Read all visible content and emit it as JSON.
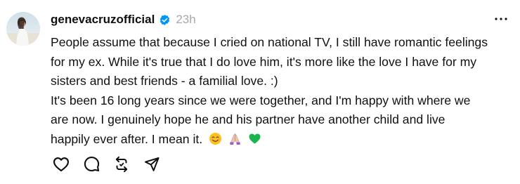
{
  "post": {
    "author": {
      "username": "genevacruzofficial",
      "verified": true
    },
    "timestamp": "23h",
    "body_lines": [
      "People assume that because I cried on national TV, I still have romantic feelings",
      "for my ex. While it's true that I do love him, it's more like the love I have for my",
      "sisters and best friends - a familial love. :)",
      "It's been 16 long years since we were together, and I'm happy with where we",
      "are now. I genuinely hope he and his partner have another child and live",
      "happily ever after. I mean it."
    ],
    "emojis": [
      "smiling-face-emoji",
      "folded-hands-emoji",
      "green-heart-emoji"
    ]
  },
  "icons": {
    "verified": "verified-badge-icon",
    "more": "more-options-icon",
    "like": "heart-icon",
    "reply": "comment-icon",
    "repost": "repost-icon",
    "share": "send-icon"
  },
  "colors": {
    "text": "#101010",
    "muted": "#a8a8a8",
    "verified": "#0095f6",
    "icon": "#101010"
  }
}
